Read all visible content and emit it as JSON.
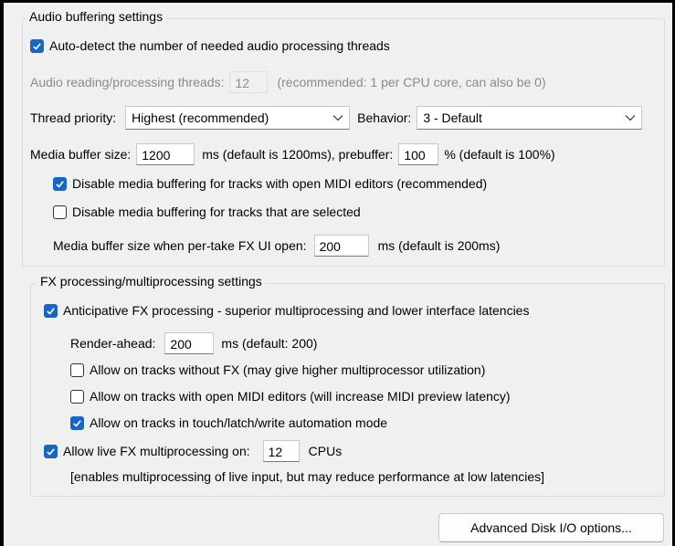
{
  "audio_group": {
    "title": "Audio buffering settings",
    "auto_detect_label": "Auto-detect the number of needed audio processing threads",
    "threads_label": "Audio reading/processing threads:",
    "threads_value": "12",
    "threads_hint": "(recommended: 1 per CPU core, can also be 0)",
    "thread_priority_label": "Thread priority:",
    "thread_priority_value": "Highest (recommended)",
    "behavior_label": "Behavior:",
    "behavior_value": "3 - Default",
    "media_buffer_label": "Media buffer size:",
    "media_buffer_value": "1200",
    "media_buffer_hint": "ms (default is 1200ms), prebuffer:",
    "prebuffer_value": "100",
    "prebuffer_hint": "% (default is 100%)",
    "disable_midi_label": "Disable media buffering for tracks with open MIDI editors (recommended)",
    "disable_selected_label": "Disable media buffering for tracks that are selected",
    "per_take_label": "Media buffer size when per-take FX UI open:",
    "per_take_value": "200",
    "per_take_hint": "ms (default is 200ms)"
  },
  "fx_group": {
    "title": "FX processing/multiprocessing settings",
    "anticipative_label": "Anticipative FX processing - superior multiprocessing and lower interface latencies",
    "render_ahead_label": "Render-ahead:",
    "render_ahead_value": "200",
    "render_ahead_hint": "ms (default: 200)",
    "allow_without_fx_label": "Allow on tracks without FX (may give higher multiprocessor utilization)",
    "allow_midi_label": "Allow on tracks with open MIDI editors (will increase MIDI preview latency)",
    "allow_automation_label": "Allow on tracks in touch/latch/write automation mode",
    "live_fx_label": "Allow live FX multiprocessing on:",
    "live_fx_value": "12",
    "live_fx_unit": "CPUs",
    "live_fx_note": "[enables multiprocessing of live input, but may reduce performance at low latencies]"
  },
  "buttons": {
    "advanced_disk_io": "Advanced Disk I/O options..."
  },
  "colors": {
    "checkbox_checked": "#1666c5",
    "background": "#f0f0f0"
  },
  "checkbox_states": {
    "auto_detect": true,
    "disable_midi": true,
    "disable_selected": false,
    "anticipative": true,
    "allow_without_fx": false,
    "allow_midi": false,
    "allow_automation": true,
    "live_fx": true
  }
}
